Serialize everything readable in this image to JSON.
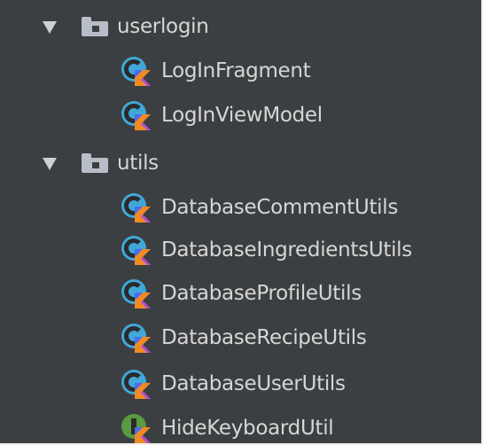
{
  "tree": {
    "folders": [
      {
        "label": "userlogin",
        "expanded": true,
        "icon": "folder-icon"
      },
      {
        "label": "utils",
        "expanded": true,
        "icon": "folder-icon"
      }
    ],
    "files": [
      {
        "label": "LogInFragment",
        "icon": "kotlin-class-icon"
      },
      {
        "label": "LogInViewModel",
        "icon": "kotlin-class-icon"
      },
      {
        "label": "DatabaseCommentUtils",
        "icon": "kotlin-class-icon"
      },
      {
        "label": "DatabaseIngredientsUtils",
        "icon": "kotlin-class-icon"
      },
      {
        "label": "DatabaseProfileUtils",
        "icon": "kotlin-class-icon"
      },
      {
        "label": "DatabaseRecipeUtils",
        "icon": "kotlin-class-icon"
      },
      {
        "label": "DatabaseUserUtils",
        "icon": "kotlin-class-icon"
      },
      {
        "label": "HideKeyboardUtil",
        "icon": "kotlin-interface-icon"
      }
    ]
  },
  "colors": {
    "background": "#3c3f41",
    "text": "#d6d6d6",
    "class_icon": "#40a8d8",
    "interface_icon": "#5a9a40",
    "kotlin_orange": "#f08a24",
    "kotlin_blue": "#4a6cf0"
  }
}
